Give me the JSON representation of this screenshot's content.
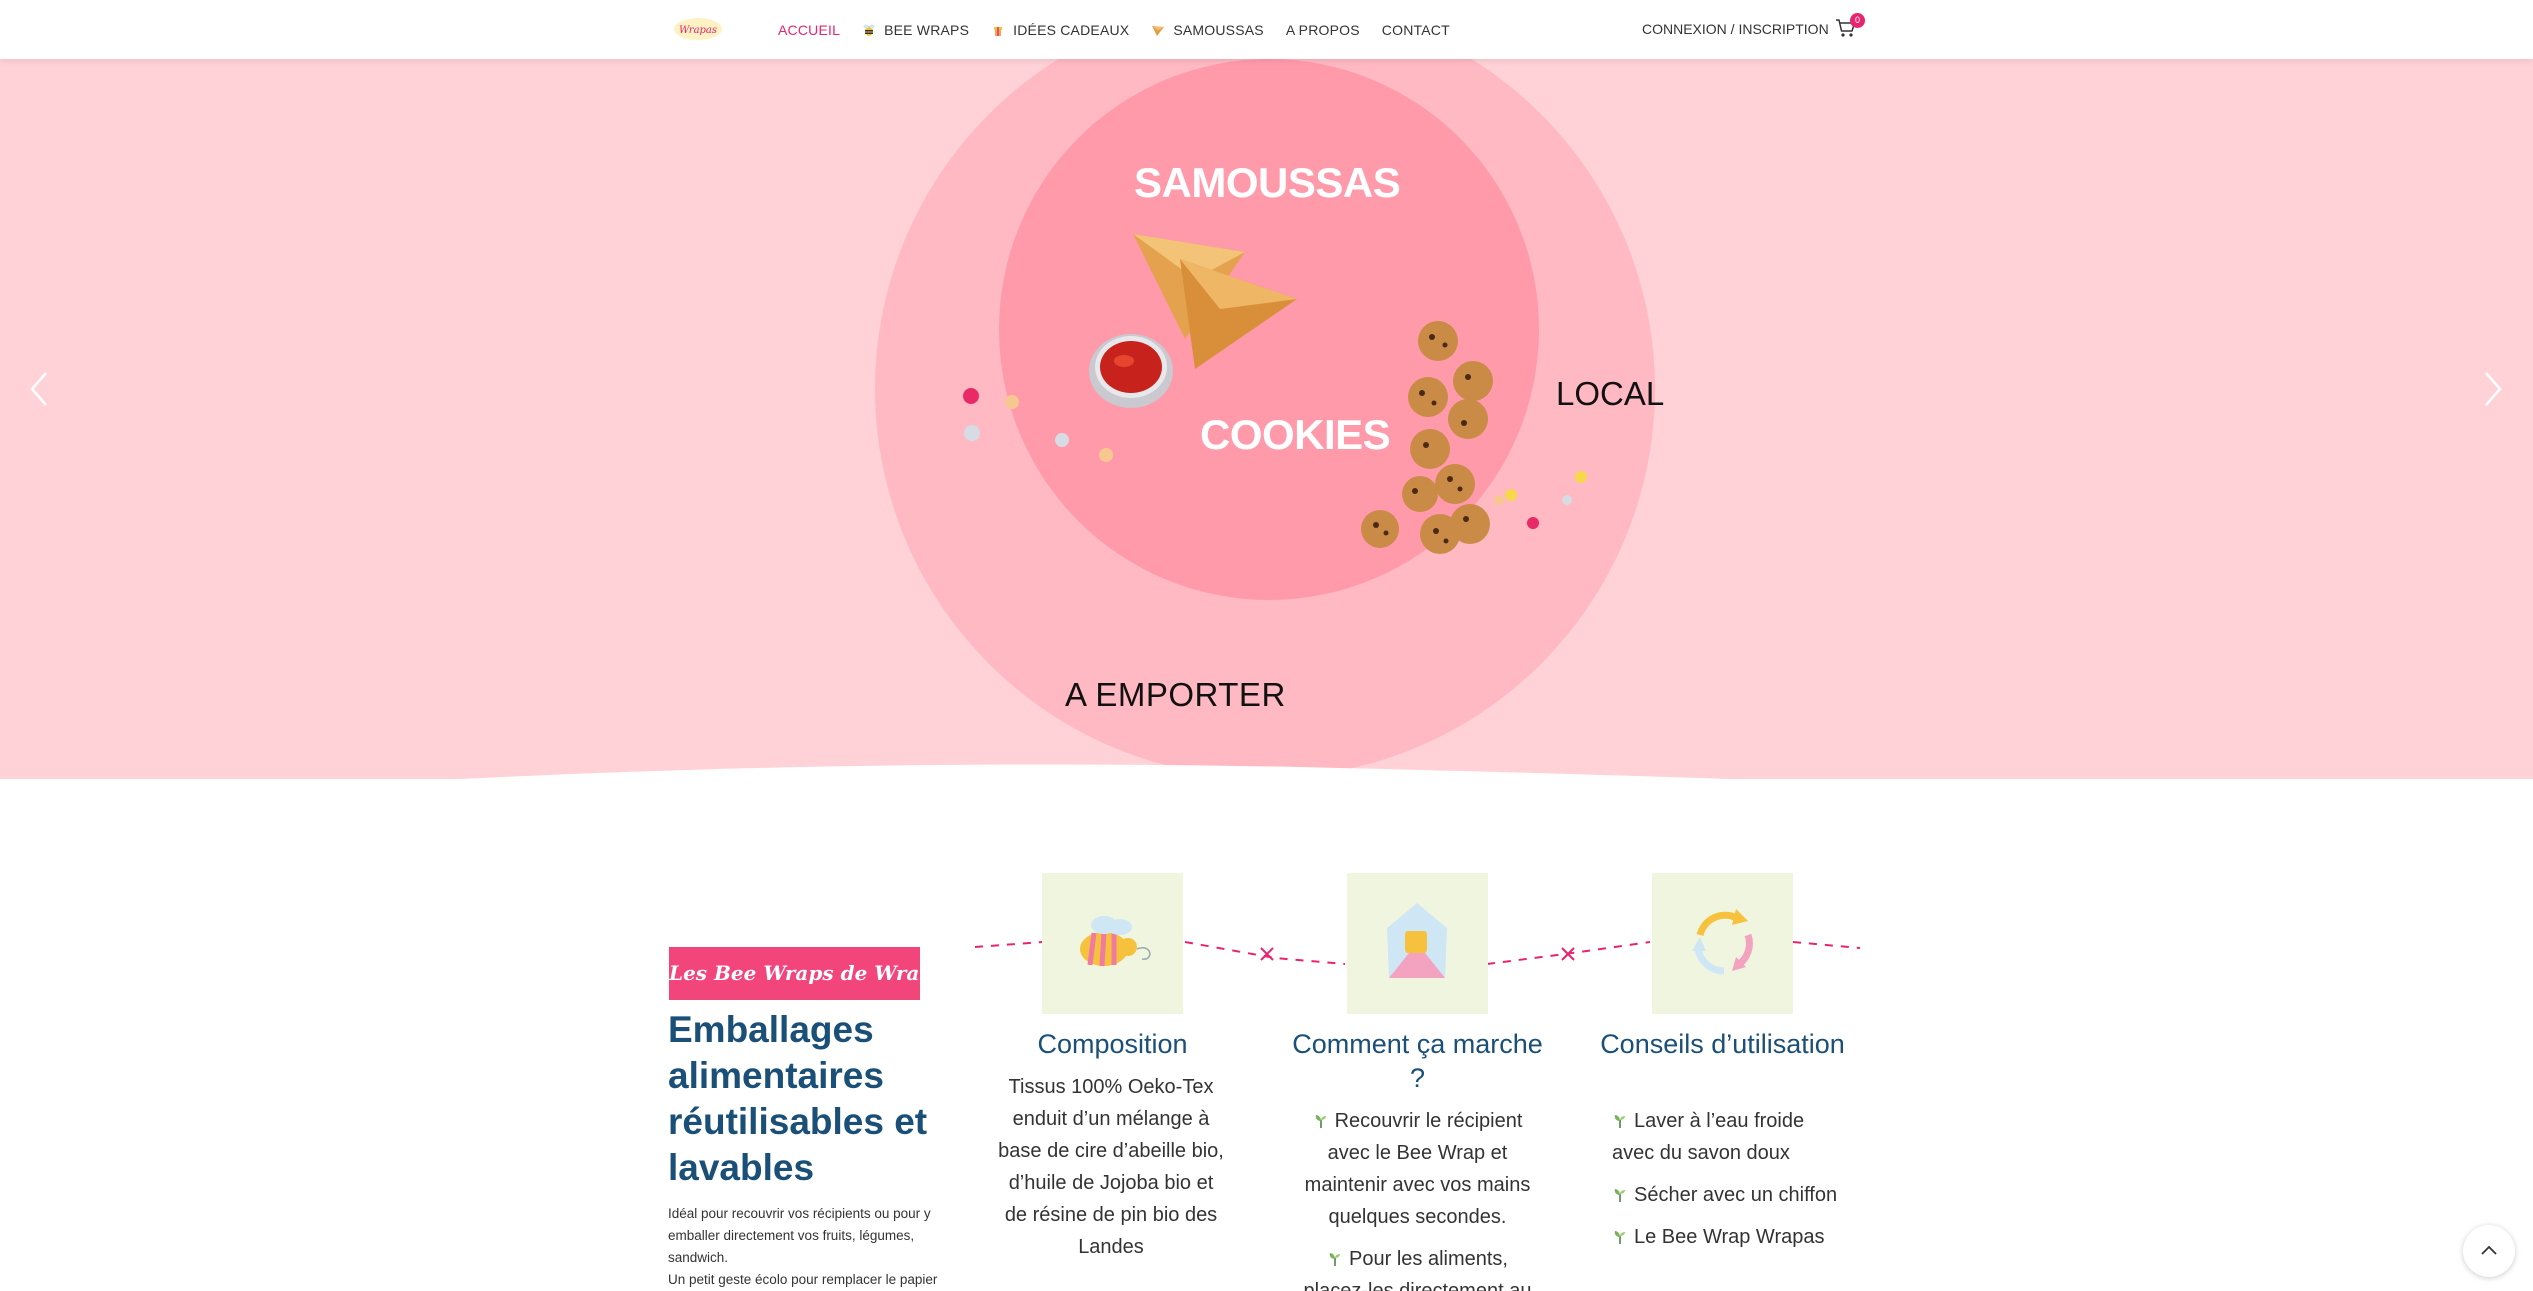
{
  "header": {
    "logo_text": "Wrapas",
    "nav": [
      {
        "label": "ACCUEIL",
        "icon": "",
        "active": true
      },
      {
        "label": "BEE WRAPS",
        "icon": "bee-icon"
      },
      {
        "label": "IDÉES CADEAUX",
        "icon": "gift-icon"
      },
      {
        "label": "SAMOUSSAS",
        "icon": "samosa-icon"
      },
      {
        "label": "A PROPOS",
        "icon": ""
      },
      {
        "label": "CONTACT",
        "icon": ""
      }
    ],
    "login": "CONNEXION / INSCRIPTION",
    "cart_count": "0"
  },
  "hero": {
    "samoussas": "SAMOUSSAS",
    "cookies": "COOKIES",
    "local": "LOCAL",
    "emporter": "A EMPORTER",
    "bg_color": "#ffd2d8",
    "circle_outer_color": "#ffb9c3",
    "circle_inner_color": "#ff9aab"
  },
  "intro": {
    "tag": "Les Bee Wraps de Wrapas",
    "headline": "Emballages alimentaires réutilisables et lavables",
    "text1": "Idéal pour recouvrir vos récipients ou pour y emballer directement vos fruits, légumes, sandwich.",
    "text2": "Un petit geste écolo pour remplacer le papier"
  },
  "features": [
    {
      "title": "Composition",
      "icon": "bee-icon",
      "text": "Tissus 100% Oeko-Tex enduit d’un mélange à base de cire d’abeille bio, d’huile de Jojoba bio et de résine de pin bio des Landes"
    },
    {
      "title": "Comment ça marche ?",
      "icon": "wrap-icon",
      "items": [
        "Recouvrir le récipient avec le Bee Wrap et maintenir avec vos mains quelques secondes.",
        "Pour les aliments, placez-les directement au"
      ]
    },
    {
      "title": "Conseils d’utilisation",
      "icon": "recycle-icon",
      "items": [
        "Laver à l’eau froide avec du savon doux",
        "Sécher avec un chiffon",
        "Le Bee Wrap Wrapas"
      ]
    }
  ],
  "colors": {
    "accent": "#e8236f",
    "tag_bg": "#f2457b",
    "heading": "#1a4f78",
    "icon_bg": "#f0f5df"
  }
}
